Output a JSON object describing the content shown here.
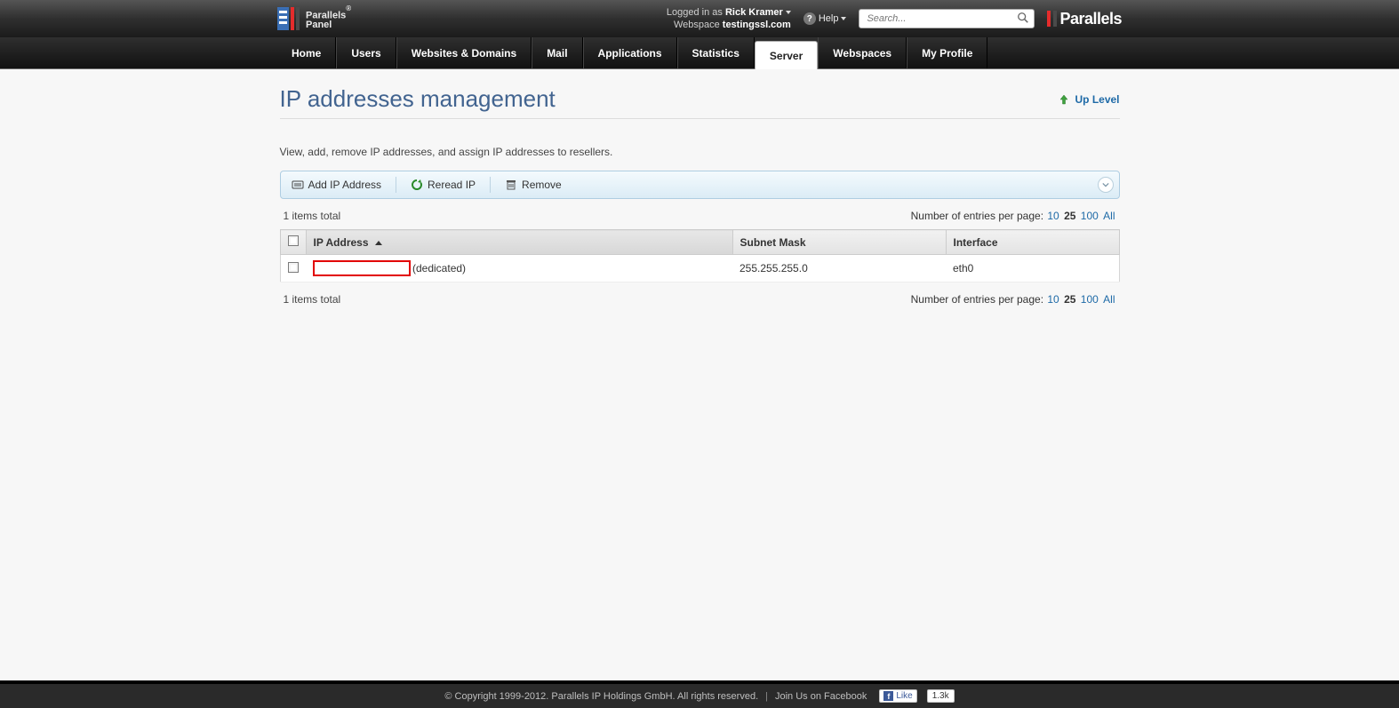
{
  "header": {
    "logo_line1": "Parallels",
    "logo_reg": "®",
    "logo_line2": "Panel",
    "logged_in_label": "Logged in as",
    "user_name": "Rick Kramer",
    "webspace_label": "Webspace",
    "webspace_value": "testingssl.com",
    "help_label": "Help",
    "search_placeholder": "Search...",
    "brand": "Parallels"
  },
  "nav": {
    "items": [
      {
        "label": "Home"
      },
      {
        "label": "Users"
      },
      {
        "label": "Websites & Domains"
      },
      {
        "label": "Mail"
      },
      {
        "label": "Applications"
      },
      {
        "label": "Statistics"
      },
      {
        "label": "Server",
        "active": true
      },
      {
        "label": "Webspaces"
      },
      {
        "label": "My Profile"
      }
    ]
  },
  "page": {
    "title": "IP addresses management",
    "uplevel": "Up Level",
    "description": "View, add, remove IP addresses, and assign IP addresses to resellers."
  },
  "toolbar": {
    "add": "Add IP Address",
    "reread": "Reread IP",
    "remove": "Remove"
  },
  "table": {
    "total_label": "1 items total",
    "perpage_label": "Number of entries per page:",
    "perpage_options": [
      "10",
      "25",
      "100",
      "All"
    ],
    "perpage_current": "25",
    "columns": {
      "ip": "IP Address",
      "mask": "Subnet Mask",
      "iface": "Interface"
    },
    "rows": [
      {
        "ip_suffix": "(dedicated)",
        "mask": "255.255.255.0",
        "iface": "eth0"
      }
    ]
  },
  "footer": {
    "copyright": "© Copyright 1999-2012. Parallels IP Holdings GmbH. All rights reserved.",
    "join_label": "Join Us on Facebook",
    "like": "Like",
    "like_count": "1.3k"
  }
}
